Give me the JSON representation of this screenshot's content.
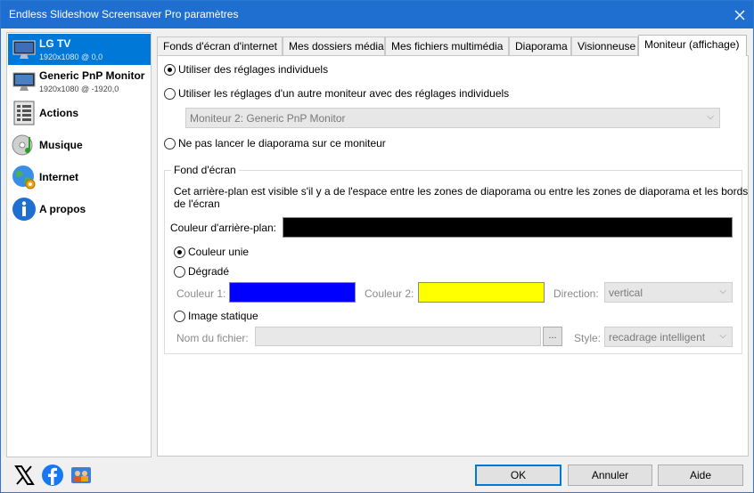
{
  "window": {
    "title": "Endless Slideshow Screensaver Pro paramètres"
  },
  "sidebar": {
    "monitors": [
      {
        "name": "LG TV",
        "sub": "1920x1080 @ 0,0"
      },
      {
        "name": "Generic PnP Monitor",
        "sub": "1920x1080 @ -1920,0"
      }
    ],
    "items": [
      {
        "label": "Actions",
        "icon": "list-icon"
      },
      {
        "label": "Musique",
        "icon": "music-disc-icon"
      },
      {
        "label": "Internet",
        "icon": "globe-icon"
      },
      {
        "label": "A propos",
        "icon": "info-icon"
      }
    ]
  },
  "tabs": [
    "Fonds d'écran d'internet",
    "Mes dossiers média",
    "Mes fichiers multimédia",
    "Diaporama",
    "Visionneuse",
    "Moniteur (affichage)"
  ],
  "active_tab": "Moniteur (affichage)",
  "panel": {
    "radio_individual": "Utiliser des réglages individuels",
    "radio_other_monitor": "Utiliser les réglages d'un autre moniteur avec des réglages individuels",
    "other_monitor_select": "Moniteur 2: Generic PnP Monitor",
    "radio_no_slideshow": "Ne pas lancer le diaporama sur ce moniteur",
    "selected_mode": "individual",
    "wallpaper_group": {
      "title": "Fond d'écran",
      "description_line1": "Cet arrière-plan est visible s'il y a de l'espace entre les zones de diaporama ou entre les zones de diaporama et les bords",
      "description_line2": "de l'écran",
      "bg_color_label": "Couleur d'arrière-plan:",
      "bg_color": "#000000",
      "radio_solid": "Couleur unie",
      "radio_gradient": "Dégradé",
      "color1_label": "Couleur 1:",
      "color1": "#0000ff",
      "color2_label": "Couleur 2:",
      "color2": "#ffff00",
      "direction_label": "Direction:",
      "direction_value": "vertical",
      "radio_static_image": "Image statique",
      "filename_label": "Nom du fichier:",
      "filename_value": "",
      "browse_label": "...",
      "style_label": "Style:",
      "style_value": "recadrage intelligent",
      "selected_background": "solid"
    }
  },
  "footer": {
    "social_icons": [
      "x-logo-icon",
      "facebook-icon",
      "community-icon"
    ],
    "ok_label": "OK",
    "cancel_label": "Annuler",
    "help_label": "Aide"
  },
  "colors": {
    "titlebar": "#1f6fd1",
    "selection": "#0078d7"
  }
}
